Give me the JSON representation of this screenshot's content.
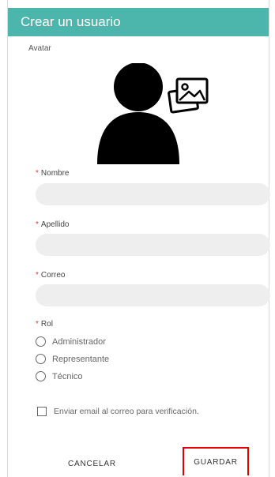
{
  "dialog": {
    "title": "Crear un usuario",
    "avatar_label": "Avatar",
    "icons": {
      "avatar": "user-silhouette-icon",
      "upload": "image-gallery-icon"
    },
    "fields": {
      "nombre": {
        "required_mark": "*",
        "label": "Nombre",
        "value": ""
      },
      "apellido": {
        "required_mark": "*",
        "label": "Apellido",
        "value": ""
      },
      "correo": {
        "required_mark": "*",
        "label": "Correo",
        "value": ""
      }
    },
    "rol": {
      "required_mark": "*",
      "label": "Rol",
      "options": [
        "Administrador",
        "Representante",
        "Técnico"
      ]
    },
    "verify_email_label": "Enviar email al correo para verificación.",
    "buttons": {
      "cancel": "CANCELAR",
      "save": "GUARDAR"
    }
  },
  "colors": {
    "header": "#4db6ac",
    "required": "#e53935",
    "highlight": "#e00000",
    "input_bg": "#eeeeee"
  }
}
